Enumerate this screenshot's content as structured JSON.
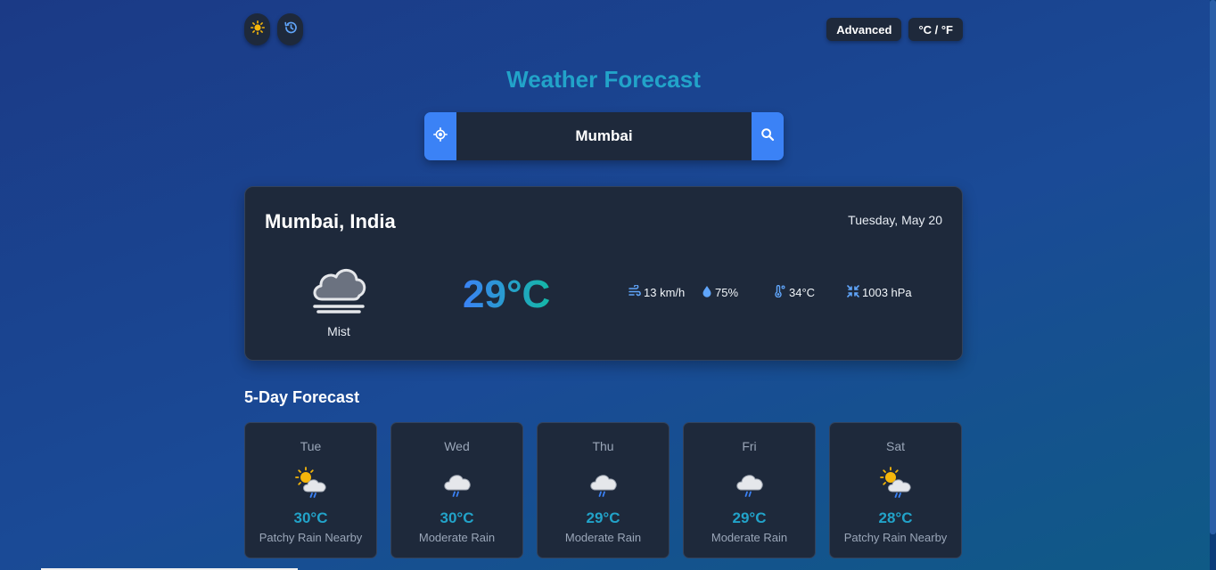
{
  "header": {
    "title": "Weather Forecast",
    "theme_icon": "sun-icon",
    "history_icon": "history-icon",
    "advanced_label": "Advanced",
    "unit_toggle_label": "°C / °F"
  },
  "search": {
    "value": "Mumbai",
    "location_icon": "crosshair-icon",
    "search_icon": "search-icon"
  },
  "current": {
    "location": "Mumbai, India",
    "date": "Tuesday, May 20",
    "icon": "mist-cloud-icon",
    "condition": "Mist",
    "temperature": "29°C",
    "wind": "13 km/h",
    "humidity": "75%",
    "feels_like": "34°C",
    "pressure": "1003 hPa"
  },
  "forecast": {
    "title": "5-Day Forecast",
    "days": [
      {
        "day": "Tue",
        "temp": "30°C",
        "condition": "Patchy Rain Nearby",
        "icon": "sun-cloud-rain-icon"
      },
      {
        "day": "Wed",
        "temp": "30°C",
        "condition": "Moderate Rain",
        "icon": "cloud-rain-icon"
      },
      {
        "day": "Thu",
        "temp": "29°C",
        "condition": "Moderate Rain",
        "icon": "cloud-rain-icon"
      },
      {
        "day": "Fri",
        "temp": "29°C",
        "condition": "Moderate Rain",
        "icon": "cloud-rain-icon"
      },
      {
        "day": "Sat",
        "temp": "28°C",
        "condition": "Patchy Rain Nearby",
        "icon": "sun-cloud-rain-icon"
      }
    ]
  },
  "colors": {
    "accent": "#3b82f6",
    "title": "#22a3c9",
    "card": "#1e293b"
  }
}
